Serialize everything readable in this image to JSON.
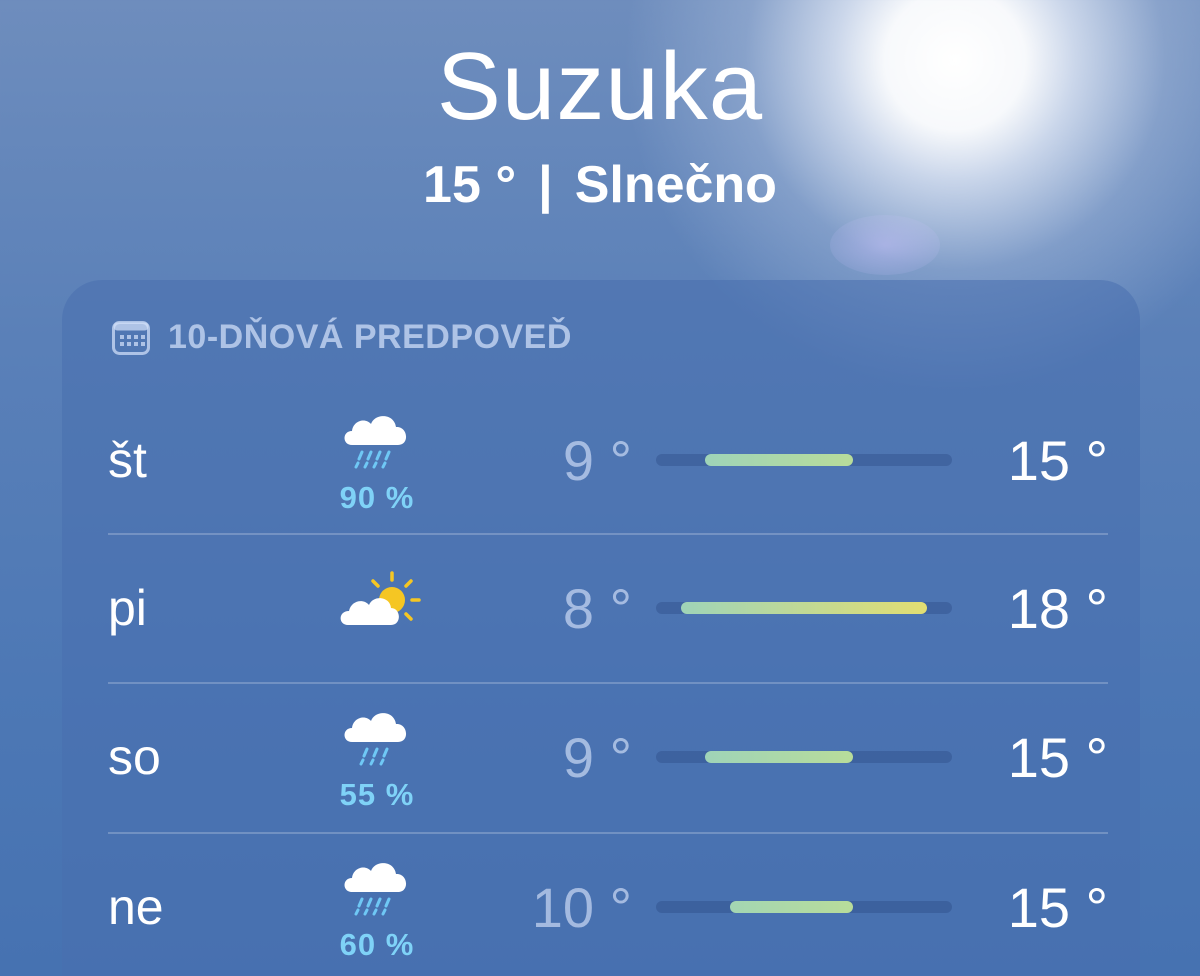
{
  "location": {
    "city": "Suzuka",
    "current_temp": "15 °",
    "separator": "|",
    "condition": "Slnečno"
  },
  "forecast": {
    "header": "10-DŇOVÁ PREDPOVEĎ",
    "header_icon": "calendar-icon",
    "range": {
      "min": 7,
      "max": 19
    },
    "days": [
      {
        "day": "št",
        "icon": "cloud-rain-icon",
        "precip": "90 %",
        "low": "9 °",
        "high": "15 °",
        "low_value": 9,
        "high_value": 15,
        "bar_colors": [
          "#9fd4b8",
          "#b8dc9a"
        ]
      },
      {
        "day": "pi",
        "icon": "partly-sunny-icon",
        "precip": "",
        "low": "8 °",
        "high": "18 °",
        "low_value": 8,
        "high_value": 18,
        "bar_colors": [
          "#9fd4b8",
          "#e2de72"
        ]
      },
      {
        "day": "so",
        "icon": "cloud-rain-icon",
        "precip": "55 %",
        "low": "9 °",
        "high": "15 °",
        "low_value": 9,
        "high_value": 15,
        "bar_colors": [
          "#9fd4b8",
          "#b8dc9a"
        ]
      },
      {
        "day": "ne",
        "icon": "cloud-rain-icon",
        "precip": "60 %",
        "low": "10 °",
        "high": "15 °",
        "low_value": 10,
        "high_value": 15,
        "bar_colors": [
          "#a3d6b3",
          "#b8dc9a"
        ]
      }
    ]
  }
}
